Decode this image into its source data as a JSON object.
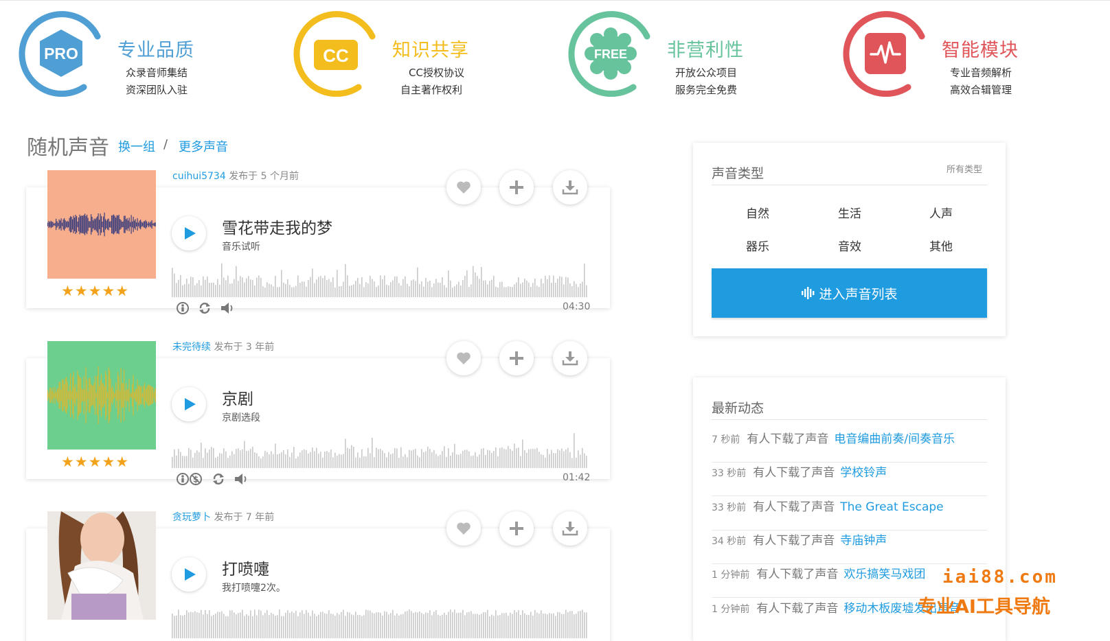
{
  "features": [
    {
      "badge": "PRO",
      "title": "专业品质",
      "line1": "众录音师集结",
      "line2": "资深团队入驻",
      "color": "#4f9fd4"
    },
    {
      "badge": "CC",
      "title": "知识共享",
      "line1": "CC授权协议",
      "line2": "自主著作权利",
      "color": "#f3bd1d"
    },
    {
      "badge": "FREE",
      "title": "非营利性",
      "line1": "开放公众项目",
      "line2": "服务完全免费",
      "color": "#67c39c"
    },
    {
      "badge": "pulse-icon",
      "title": "智能模块",
      "line1": "专业音频解析",
      "line2": "高效合辑管理",
      "color": "#e0555a"
    }
  ],
  "section": {
    "title": "随机声音",
    "link_shuffle": "换一组",
    "separator": "/",
    "link_more": "更多声音"
  },
  "sounds": [
    {
      "author": "cuihui5734",
      "posted": "发布于 5 个月前",
      "title": "雪花带走我的梦",
      "subtitle": "音乐试听",
      "duration": "04:30",
      "stars": "★★★★★",
      "thumb_bg": "#f6ae8c",
      "wave_color": "#1d2d7a",
      "rating": 5
    },
    {
      "author": "未完待续",
      "posted": "发布于 3 年前",
      "title": "京剧",
      "subtitle": "京剧选段",
      "duration": "01:42",
      "stars": "★★★★★",
      "thumb_bg": "#6dcf8e",
      "wave_color": "#e3b52b",
      "rating": 5
    },
    {
      "author": "贪玩萝卜",
      "posted": "发布于 7 年前",
      "title": "打喷嚏",
      "subtitle": "我打喷嚏2次。",
      "duration": "",
      "stars": "",
      "thumb_bg": "#e8e3de",
      "wave_color": "",
      "rating": null
    }
  ],
  "types_panel": {
    "title": "声音类型",
    "all_link": "所有类型",
    "types": [
      "自然",
      "生活",
      "人声",
      "器乐",
      "音效",
      "其他"
    ],
    "enter_button": "进入声音列表"
  },
  "news_panel": {
    "title": "最新动态",
    "items": [
      {
        "time": "7 秒前",
        "msg": "有人下载了声音",
        "link": "电音编曲前奏/间奏音乐"
      },
      {
        "time": "33 秒前",
        "msg": "有人下载了声音",
        "link": "学校铃声"
      },
      {
        "time": "33 秒前",
        "msg": "有人下载了声音",
        "link": "The Great Escape"
      },
      {
        "time": "34 秒前",
        "msg": "有人下载了声音",
        "link": "寺庙钟声"
      },
      {
        "time": "1 分钟前",
        "msg": "有人下载了声音",
        "link": "欢乐搞笑马戏团"
      },
      {
        "time": "1 分钟前",
        "msg": "有人下载了声音",
        "link": "移动木板废墟发出声音"
      }
    ]
  },
  "watermark": {
    "line1": "iai88.com",
    "line2": "专业AI工具导航",
    "color": "#f07a12"
  },
  "colors": {
    "accent": "#1f9be0",
    "star": "#f3a31b"
  }
}
